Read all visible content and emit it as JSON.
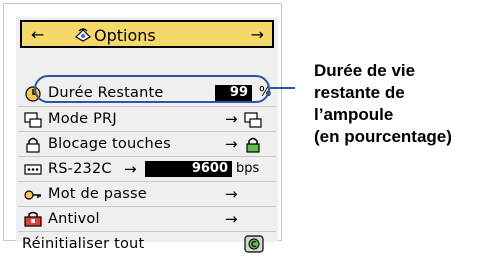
{
  "menu": {
    "title": "Options",
    "title_icon": "options-icon",
    "nav_left": "←",
    "nav_right": "→",
    "items": [
      {
        "label": "Durée Restante",
        "icon": "clock-icon",
        "value": "99",
        "unit": "%"
      },
      {
        "label": "Mode PRJ",
        "icon": "projector-mode-icon",
        "arrow": "→"
      },
      {
        "label": "Blocage touches",
        "icon": "lock-icon",
        "arrow": "→"
      },
      {
        "label": "RS-232C",
        "icon": "rs232c-icon",
        "arrow": "→",
        "value": "9600",
        "unit": "bps"
      },
      {
        "label": "Mot de passe",
        "icon": "key-icon",
        "arrow": "→"
      },
      {
        "label": "Antivol",
        "icon": "antitheft-icon",
        "arrow": "→"
      },
      {
        "label": "Réinitialiser tout",
        "icon": "reset-icon"
      }
    ]
  },
  "callout": {
    "lines": [
      "Durée de vie",
      "restante de",
      "l’ampoule",
      "(en pourcentage)"
    ]
  },
  "colors": {
    "header_bg": "#f4d96a",
    "menu_bg": "#efefef",
    "highlight": "#2a55a8"
  }
}
